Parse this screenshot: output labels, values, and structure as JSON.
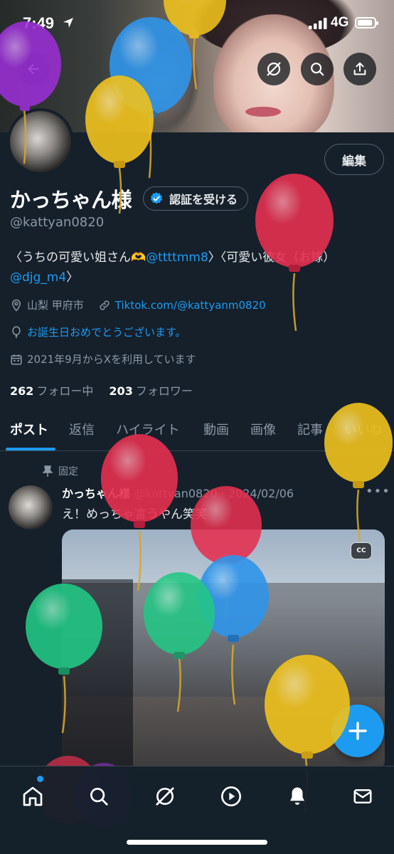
{
  "status_bar": {
    "time": "7:49",
    "network": "4G"
  },
  "header": {
    "back_icon": "arrow-left-icon",
    "grok_icon": "grok-icon",
    "search_icon": "search-icon",
    "share_icon": "share-icon"
  },
  "profile": {
    "edit_label": "編集",
    "display_name": "かっちゃん様",
    "verify_label": "認証を受ける",
    "handle": "@kattyan0820",
    "bio": {
      "part1": "〈うちの可愛い姐さん🫶",
      "link1": "@ttttmm8",
      "part2": "〉〈可愛い彼女（お嫁）",
      "link2": "@djg_m4",
      "part3": "〉"
    },
    "location": "山梨 甲府市",
    "website": "Tiktok.com/@kattyanm0820",
    "birthday": "お誕生日おめでとうございます。",
    "joined": "2021年9月からXを利用しています",
    "following_count": "262",
    "following_label": "フォロー中",
    "followers_count": "203",
    "followers_label": "フォロワー"
  },
  "tabs": [
    "ポスト",
    "返信",
    "ハイライト",
    "動画",
    "画像",
    "記事",
    "いいね"
  ],
  "active_tab": "ポスト",
  "post": {
    "pinned_label": "固定",
    "author_name": "かっちゃん様",
    "author_handle": "@kattyan0820",
    "separator": "·",
    "date": "2024/02/06",
    "text": "え！めっちゃ言うやん笑笑",
    "cc_label": "CC"
  },
  "colors": {
    "background": "#15202b",
    "accent": "#1d9bf0",
    "muted": "#8b98a5",
    "balloon_purple": "#9b2fd6",
    "balloon_blue": "#2f95ea",
    "balloon_yellow": "#f0c21c",
    "balloon_red": "#e5304f",
    "balloon_green": "#22c784"
  }
}
